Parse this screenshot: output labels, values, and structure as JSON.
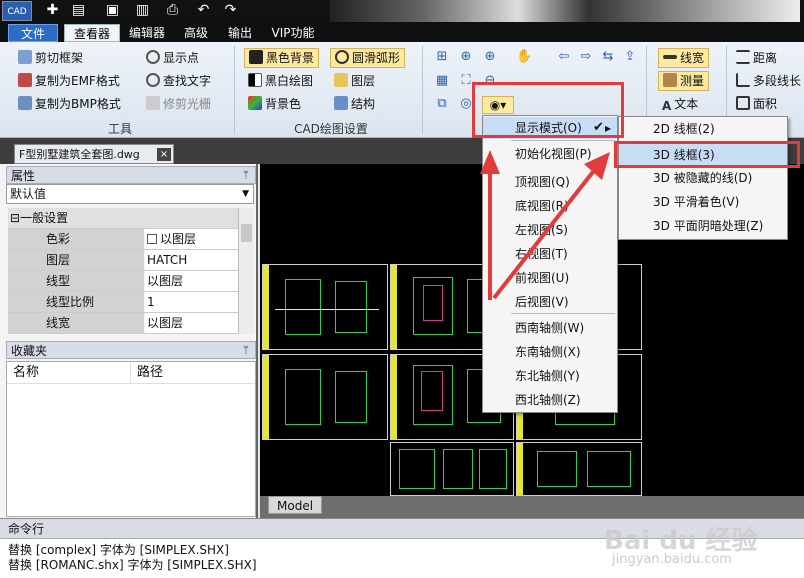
{
  "app": {
    "logo": "CAD"
  },
  "menu_tabs": [
    "文件",
    "查看器",
    "编辑器",
    "高级",
    "输出",
    "VIP功能"
  ],
  "ribbon": {
    "col1": [
      "剪切框架",
      "复制为EMF格式",
      "复制为BMP格式"
    ],
    "col2": [
      "显示点",
      "查找文字",
      "修剪光栅"
    ],
    "col3": [
      "黑色背景",
      "黑白绘图",
      "背景色"
    ],
    "col4": [
      "圆滑弧形",
      "图层",
      "结构"
    ],
    "col5": [
      "线宽",
      "测量",
      "文本"
    ],
    "col6": [
      "距离",
      "多段线长",
      "面积"
    ],
    "groups": [
      "工具",
      "CAD绘图设置"
    ]
  },
  "document_tab": {
    "title": "F型别墅建筑全套图.dwg",
    "close": "×"
  },
  "properties": {
    "title": "属性",
    "pin": "ᛘ",
    "dropdown_value": "默认值",
    "section": "一般设置",
    "section_toggle": "⊟",
    "rows": [
      {
        "key": "色彩",
        "value": "以图层",
        "swatch": "#ffffff"
      },
      {
        "key": "图层",
        "value": "HATCH"
      },
      {
        "key": "线型",
        "value": "以图层"
      },
      {
        "key": "线型比例",
        "value": "1"
      },
      {
        "key": "线宽",
        "value": "以图层"
      }
    ]
  },
  "favorites": {
    "title": "收藏夹",
    "pin": "ᛘ",
    "col_name": "名称",
    "col_path": "路径"
  },
  "canvas": {
    "model_tab": "Model"
  },
  "display_menu": {
    "items": [
      "显示模式(O)",
      "初始化视图(P)",
      "顶视图(Q)",
      "底视图(R)",
      "左视图(S)",
      "右视图(T)",
      "前视图(U)",
      "后视图(V)",
      "西南轴侧(W)",
      "东南轴侧(X)",
      "东北轴侧(Y)",
      "西北轴侧(Z)"
    ],
    "arrow": "▸"
  },
  "display_submenu": {
    "items": [
      "2D 线框(2)",
      "3D 线框(3)",
      "3D 被隐藏的线(D)",
      "3D 平滑着色(V)",
      "3D 平面阴暗处理(Z)"
    ],
    "check": "✔"
  },
  "command": {
    "title": "命令行",
    "lines": [
      "替换 [complex] 字体为 [SIMPLEX.SHX]",
      "替换 [ROMANC.shx] 字体为 [SIMPLEX.SHX]"
    ]
  },
  "watermark": {
    "text": "Bai du 经验",
    "url": "jingyan.baidu.com"
  },
  "colors": {
    "menu_highlight": "#2c6cc8",
    "annotation_red": "#e33b3b",
    "canvas_bg": "#000000"
  }
}
